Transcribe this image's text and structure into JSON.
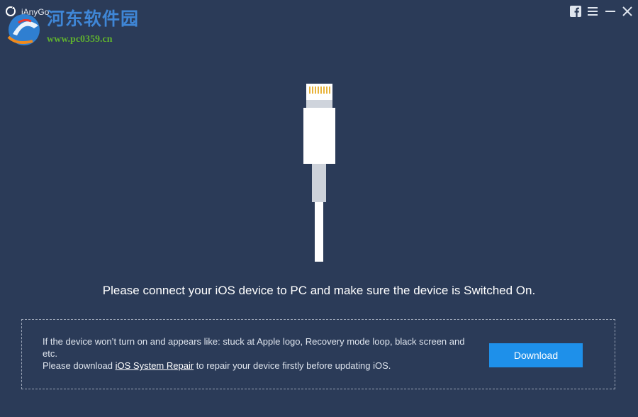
{
  "app": {
    "title": "iAnyGo"
  },
  "watermark": {
    "name": "河东软件园",
    "url": "www.pc0359.cn"
  },
  "window_controls": {
    "icons": [
      "facebook-icon",
      "menu-icon",
      "minimize-icon",
      "close-icon"
    ]
  },
  "main": {
    "message": "Please connect your iOS device to PC and make sure the device is Switched On.",
    "info": {
      "line1": "If the device won’t turn on and appears like: stuck at Apple logo, Recovery mode loop, black screen and etc.",
      "line2_prefix": "Please download ",
      "link_text": "iOS System Repair",
      "line2_suffix": " to repair your device firstly before updating iOS."
    },
    "download_label": "Download"
  },
  "colors": {
    "background": "#2b3b58",
    "accent": "#1e90ea",
    "border": "#9aa4b6",
    "watermark_blue": "#3f86d6",
    "watermark_green": "#5fb02f"
  }
}
